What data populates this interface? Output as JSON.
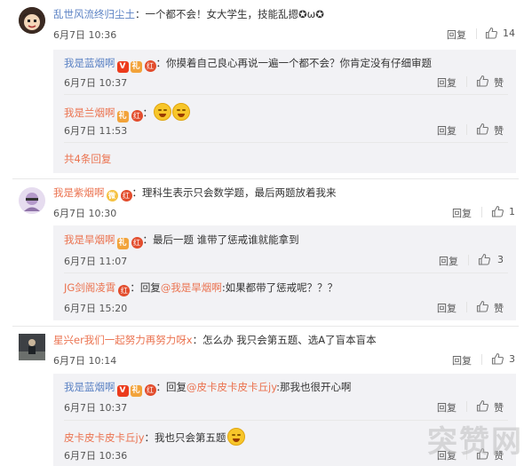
{
  "comments": [
    {
      "user": "乱世风流终归尘土",
      "text": "一个都不会！女大学生，技能乱摁✪ω✪",
      "time": "6月7日 10:36",
      "reply": "回复",
      "likes": "14",
      "replies": [
        {
          "user": "我是蓝烟啊",
          "text": "你摸着自己良心再说一遍一个都不会？你肯定没有仔细审题",
          "time": "6月7日 10:37",
          "reply": "回复",
          "likes": "赞"
        },
        {
          "user": "我是兰烟啊",
          "text": "",
          "time": "6月7日 11:53",
          "reply": "回复",
          "likes": "赞"
        }
      ],
      "more": "共4条回复"
    },
    {
      "user": "我是紫烟啊",
      "text": "理科生表示只会数学题，最后两题放着我来",
      "time": "6月7日 10:30",
      "reply": "回复",
      "likes": "1",
      "replies": [
        {
          "user": "我是旱烟啊",
          "text": "最后一题 谁带了惩戒谁就能拿到",
          "time": "6月7日 11:07",
          "reply": "回复",
          "likes": "3"
        },
        {
          "user": "JG剑阁凌霄",
          "reply_prefix": "回复",
          "mention": "@我是旱烟啊",
          "text": ":如果都带了惩戒呢？？？",
          "time": "6月7日 15:20",
          "reply": "回复",
          "likes": "赞"
        }
      ]
    },
    {
      "user": "星兴er我们一起努力再努力呀x",
      "text": "怎么办 我只会第五题、选A了盲本盲本",
      "time": "6月7日 10:14",
      "reply": "回复",
      "likes": "3",
      "replies": [
        {
          "user": "我是蓝烟啊",
          "reply_prefix": "回复",
          "mention": "@皮卡皮卡皮卡丘jy",
          "text": ":那我也很开心啊",
          "time": "6月7日 10:37",
          "reply": "回复",
          "likes": "赞"
        },
        {
          "user": "皮卡皮卡皮卡丘jy",
          "text": "我也只会第五题",
          "time": "6月7日 10:36",
          "reply": "回复",
          "likes": "赞"
        }
      ]
    }
  ],
  "badges": {
    "vip": "V",
    "gift": "礼",
    "hong": "红",
    "wb": "微"
  },
  "sep": "：",
  "watermark": "突赞网"
}
